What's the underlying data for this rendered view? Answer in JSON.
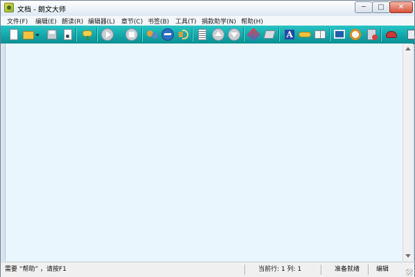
{
  "window": {
    "title": "文档 - 朗文大师",
    "controls": {
      "minimize": "─",
      "maximize": "□",
      "close": "✕"
    }
  },
  "menubar": {
    "items": [
      "文件(F)",
      "编辑(E)",
      "朗读(R)",
      "编辑器(L)",
      "章节(C)",
      "书签(B)",
      "工具(T)",
      "捐款助学(N)",
      "帮助(H)"
    ]
  },
  "toolbar": {
    "buttons": [
      "new-document",
      "open-folder",
      "save",
      "print-music",
      "key-settings",
      "play",
      "stop",
      "voices",
      "speak-all",
      "volume",
      "list",
      "move-up",
      "move-down",
      "convert",
      "brush",
      "font-a",
      "dictionary",
      "book",
      "monitor",
      "alarm-clock",
      "timer",
      "speaker-hat",
      "partial-icon"
    ]
  },
  "colors": {
    "toolbar_top": "#29c4c4",
    "toolbar_bottom": "#0c8f93",
    "content_background": "#e9f6fd",
    "play_circle": "#c9ced4"
  },
  "statusbar": {
    "help": "需要 “帮助” ，请按F1",
    "position": "当前行: 1   列: 1",
    "state": "准备就绪",
    "mode": "编辑"
  }
}
